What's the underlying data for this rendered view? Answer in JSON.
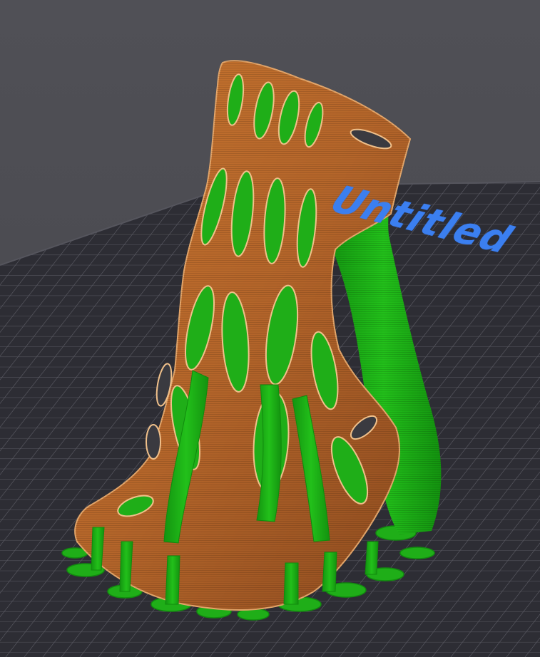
{
  "viewer": {
    "bed_label": "Untitled",
    "colors": {
      "background": "#4f4f55",
      "bed": "#2c2c33",
      "bed_grid": "#5a5a63",
      "model_perimeter": "#b8682a",
      "support_material": "#1fae18",
      "first_layer_infill": "#1d4a8a",
      "bed_label": "#3b7ff0"
    },
    "objects": [
      {
        "name": "sliced-model",
        "feature": "perimeter"
      },
      {
        "name": "tree-supports",
        "feature": "support-material"
      }
    ]
  }
}
